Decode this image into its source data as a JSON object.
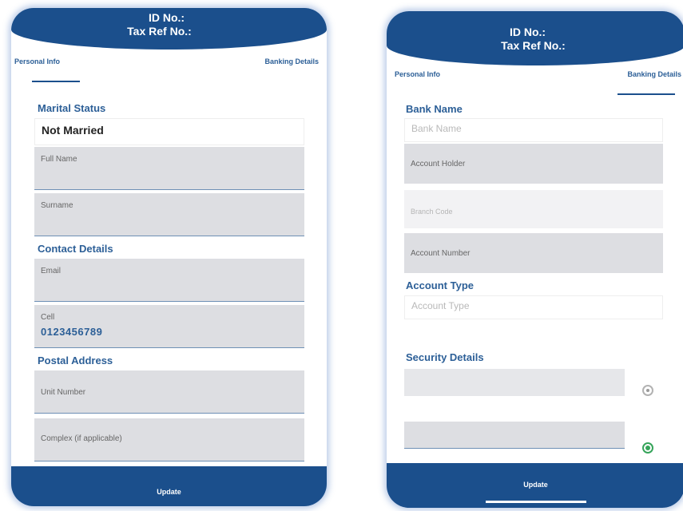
{
  "colors": {
    "brand_blue": "#1b4f8c",
    "label_blue": "#2c5f97",
    "field_grey": "#dddee2",
    "toggle_green": "#36a45a"
  },
  "left": {
    "header": {
      "id_label": "ID No.:",
      "tax_label": "Tax Ref No.:"
    },
    "tabs": {
      "personal": "Personal Info",
      "banking": "Banking Details",
      "active": "personal"
    },
    "marital": {
      "title": "Marital Status",
      "value": "Not Married"
    },
    "full_name": {
      "label": "Full Name"
    },
    "surname": {
      "label": "Surname"
    },
    "contact": {
      "title": "Contact Details"
    },
    "email": {
      "label": "Email"
    },
    "cell": {
      "label": "Cell",
      "value": "0123456789"
    },
    "postal": {
      "title": "Postal Address"
    },
    "unit": {
      "label": "Unit Number"
    },
    "complex": {
      "label": "Complex (if applicable)"
    },
    "footer": {
      "update": "Update"
    }
  },
  "right": {
    "header": {
      "id_label": "ID No.:",
      "tax_label": "Tax Ref No.:"
    },
    "tabs": {
      "personal": "Personal Info",
      "banking": "Banking Details",
      "active": "banking"
    },
    "bank": {
      "title": "Bank Name",
      "placeholder": "Bank Name"
    },
    "holder": {
      "label": "Account Holder"
    },
    "branch": {
      "placeholder": "Branch Code"
    },
    "acc_number": {
      "label": "Account Number"
    },
    "acc_type": {
      "title": "Account Type",
      "placeholder": "Account Type"
    },
    "security": {
      "title": "Security Details"
    },
    "password_visibility_icon": "eye-icon",
    "confirm_visibility_icon": "eye-icon",
    "footer": {
      "update": "Update"
    }
  }
}
